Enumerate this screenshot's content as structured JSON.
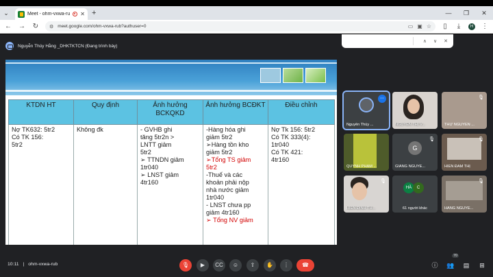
{
  "browser": {
    "tab_title": "Meet - ohm-vxwa-rub",
    "new_tab": "+",
    "url": "meet.google.com/ohm-vxwa-rub?authuser=0",
    "profile_initial": "H"
  },
  "meet": {
    "presenter_label": "Nguyễn Thúy Hằng _DHKTKTCN (Đang trình bày)",
    "participant_count": "70",
    "meeting_code": "ohm-vxwa-rub",
    "time": "10:11",
    "separator": "|"
  },
  "slide": {
    "headers": [
      "KTDN   HT",
      "Quy định",
      "Ảnh hưởng BCKQKD",
      "Ảnh hưởng BCĐKT",
      "Điều chỉnh"
    ],
    "col1": [
      "Nợ TK632: 5tr2",
      "  Có TK 156:",
      "5tr2"
    ],
    "col2": [
      "Không đk"
    ],
    "col3": [
      "-   GVHB ghi",
      "    tăng 5tr2n >",
      "    LNTT giảm",
      "    5tr2",
      "➢  TTNDN giảm",
      "    1tr040",
      "➢  LNST giảm",
      "    4tr160"
    ],
    "col4a": [
      "-Hàng hóa  ghi",
      " giảm 5tr2",
      "➢Hàng tồn kho",
      " giảm 5tr2"
    ],
    "col4red1": [
      "➢Tổng TS giảm",
      "5tr2"
    ],
    "col4b": [
      "-Thuế và các",
      " khoản phải nộp",
      " nhà nước giảm",
      " 1tr040",
      "- LNST chưa pp",
      " giảm 4tr160"
    ],
    "col4red2": [
      "➢ Tổng NV giảm"
    ],
    "col5": [
      "Nợ Tk 156: 5tr2",
      "  Có TK 333(4):",
      "1tr040",
      "Có TK 421:",
      "4tr160"
    ]
  },
  "participants": [
    {
      "name": "Nguyễn Thúy ...",
      "initial": ""
    },
    {
      "name": "NGUYỄN THỊ V...",
      "initial": ""
    },
    {
      "name": "THƯ NGUYỄN ...",
      "initial": ""
    },
    {
      "name": "QUỲNH PHẠM ...",
      "initial": ""
    },
    {
      "name": "GIANG NGUYỄ...",
      "initial": "G"
    },
    {
      "name": "HIỀN ĐÀM THỊ",
      "initial": ""
    },
    {
      "name": "HIỀN ĐINH TH...",
      "initial": ""
    },
    {
      "name": "61 người khác",
      "initial": "HÀ"
    },
    {
      "name": "HẰNG NGUYỄ...",
      "initial": ""
    }
  ],
  "others_initial_2": "C",
  "colors": {
    "meet_bg": "#202124",
    "header_cell": "#5cc2e2",
    "accent_red": "#d20000",
    "end_call": "#ea4335"
  },
  "icons": [
    "search-tab-icon",
    "record-icon",
    "back-icon",
    "forward-icon",
    "reload-icon",
    "site-info-icon",
    "cast-icon",
    "bookmark-icon",
    "mic-off-icon",
    "camera-icon",
    "captions-icon",
    "emoji-icon",
    "present-icon",
    "raise-hand-icon",
    "more-icon",
    "end-call-icon",
    "info-icon",
    "people-icon",
    "chat-icon",
    "activities-icon"
  ]
}
